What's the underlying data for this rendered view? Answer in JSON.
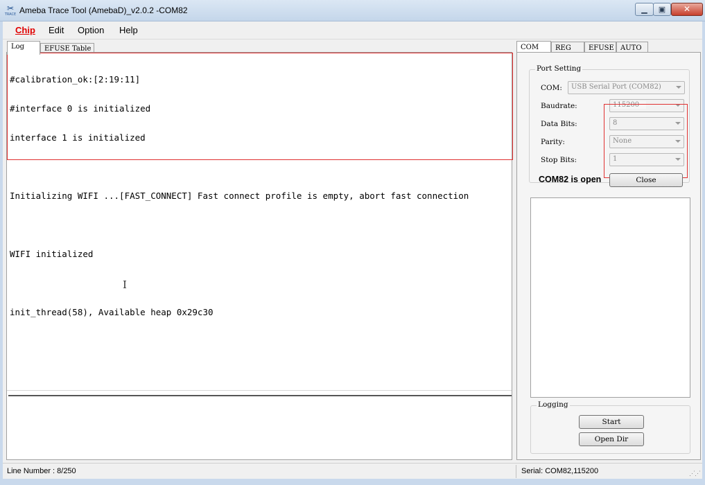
{
  "window": {
    "title": "Ameba Trace Tool (AmebaD)_v2.0.2 -COM82",
    "icon_label": "TRACE"
  },
  "menu": [
    "Chip",
    "Edit",
    "Option",
    "Help"
  ],
  "left_tabs": [
    "Log",
    "EFUSE Table"
  ],
  "log_lines": [
    "#calibration_ok:[2:19:11]",
    "#interface 0 is initialized",
    "interface 1 is initialized",
    "",
    "Initializing WIFI ...[FAST_CONNECT] Fast connect profile is empty, abort fast connection",
    "",
    "WIFI initialized",
    "",
    "init_thread(58), Available heap 0x29c30"
  ],
  "right_tabs": [
    "COM",
    "REG",
    "EFUSE",
    "AUTO"
  ],
  "port_setting": {
    "legend": "Port Setting",
    "com_label": "COM:",
    "com_value": "USB Serial Port (COM82)",
    "baudrate_label": "Baudrate:",
    "baudrate_value": "115200",
    "databits_label": "Data Bits:",
    "databits_value": "8",
    "parity_label": "Parity:",
    "parity_value": "None",
    "stopbits_label": "Stop Bits:",
    "stopbits_value": "1",
    "status": "COM82 is open",
    "close_label": "Close"
  },
  "logging": {
    "legend": "Logging",
    "start_label": "Start",
    "opendir_label": "Open Dir"
  },
  "statusbar": {
    "line_number": "Line Number : 8/250",
    "serial": "Serial: COM82,115200"
  },
  "colors": {
    "highlight_border": "#e03030",
    "menu_chip": "#e00000"
  }
}
